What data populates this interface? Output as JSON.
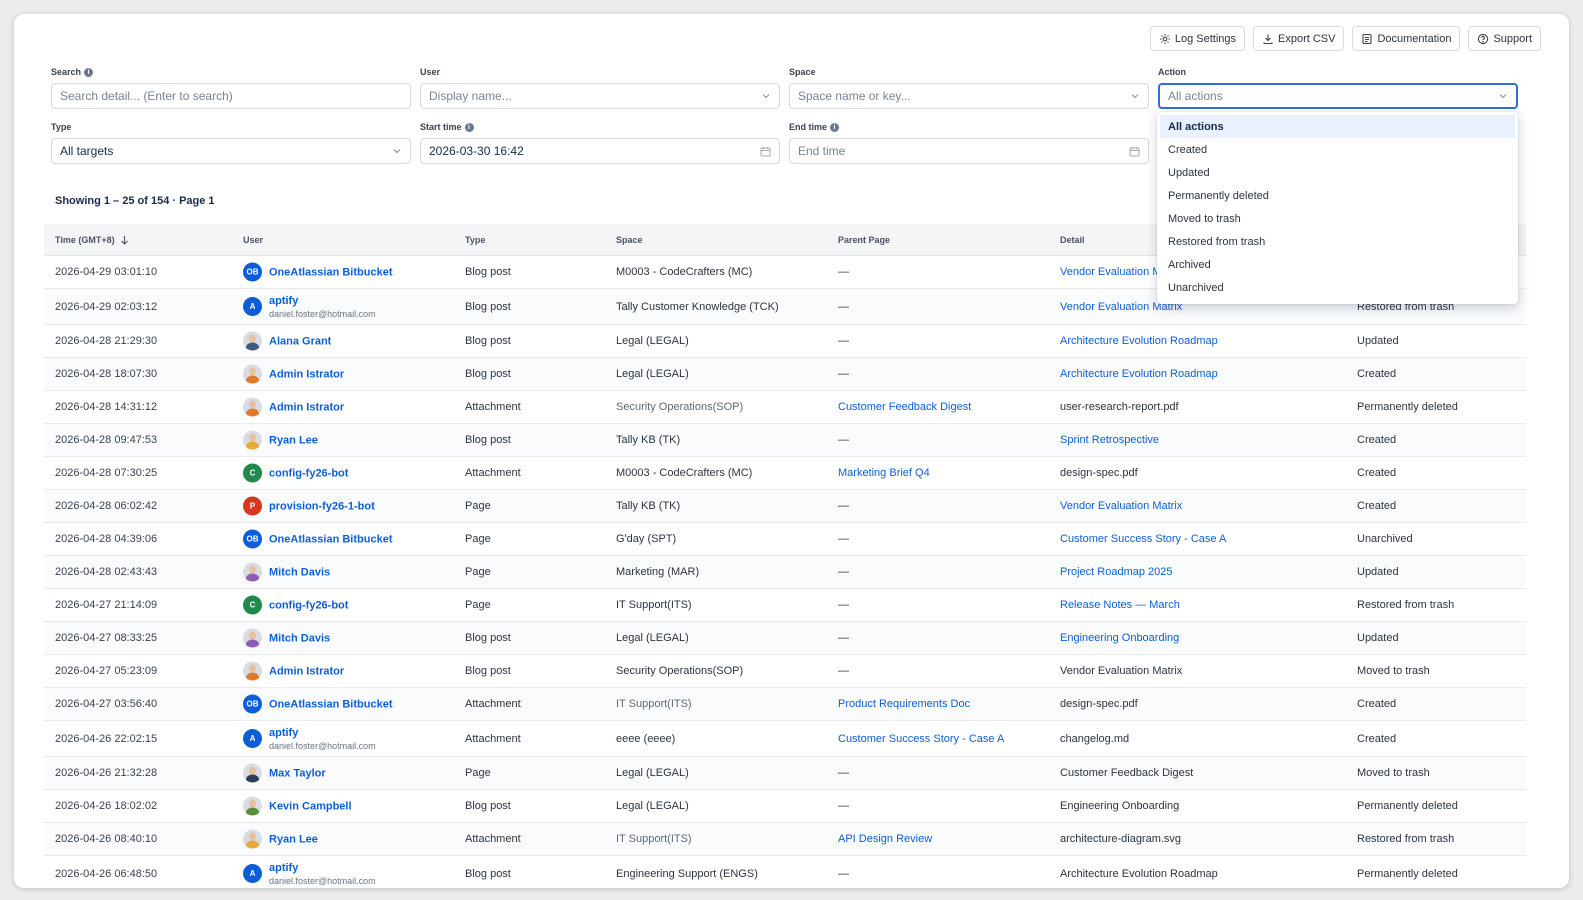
{
  "toolbar": {
    "log_settings": "Log Settings",
    "export_csv": "Export CSV",
    "documentation": "Documentation",
    "support": "Support"
  },
  "filters": {
    "search": {
      "label": "Search",
      "placeholder": "Search detail... (Enter to search)"
    },
    "user": {
      "label": "User",
      "placeholder": "Display name..."
    },
    "space": {
      "label": "Space",
      "placeholder": "Space name or key..."
    },
    "action": {
      "label": "Action",
      "value": "All actions"
    },
    "type": {
      "label": "Type",
      "value": "All targets"
    },
    "start_time": {
      "label": "Start time",
      "value": "2026-03-30 16:42"
    },
    "end_time": {
      "label": "End time",
      "placeholder": "End time"
    }
  },
  "action_menu": {
    "options": [
      "All actions",
      "Created",
      "Updated",
      "Permanently deleted",
      "Moved to trash",
      "Restored from trash",
      "Archived",
      "Unarchived"
    ],
    "selected": "All actions"
  },
  "summary": "Showing 1 – 25 of 154 · Page 1",
  "table": {
    "headers": {
      "time": "Time (GMT+8)",
      "user": "User",
      "type": "Type",
      "space": "Space",
      "parent": "Parent Page",
      "detail": "Detail"
    },
    "rows": [
      {
        "time": "2026-04-29 03:01:10",
        "user": "OneAtlassian Bitbucket",
        "initials": "OB",
        "avatar": "initials",
        "color": "#0b5ed7",
        "type": "Blog post",
        "space": "M0003 - CodeCrafters (MC)",
        "parent": "—",
        "detail": "Vendor Evaluation Matrix",
        "detail_link": true,
        "action": ""
      },
      {
        "time": "2026-04-29 02:03:12",
        "user": "aptify",
        "email": "daniel.foster@hotmail.com",
        "initials": "A",
        "avatar": "initials",
        "color": "#0b5ed7",
        "type": "Blog post",
        "space": "Tally Customer Knowledge (TCK)",
        "parent": "—",
        "detail": "Vendor Evaluation Matrix",
        "detail_link": true,
        "action": "Restored from trash"
      },
      {
        "time": "2026-04-28 21:29:30",
        "user": "Alana Grant",
        "avatar": "photo",
        "color": "#3d5a80",
        "type": "Blog post",
        "space": "Legal (LEGAL)",
        "parent": "—",
        "detail": "Architecture Evolution Roadmap",
        "detail_link": true,
        "action": "Updated"
      },
      {
        "time": "2026-04-28 18:07:30",
        "user": "Admin Istrator",
        "avatar": "photo",
        "color": "#e07a2f",
        "type": "Blog post",
        "space": "Legal (LEGAL)",
        "parent": "—",
        "detail": "Architecture Evolution Roadmap",
        "detail_link": true,
        "action": "Created"
      },
      {
        "time": "2026-04-28 14:31:12",
        "user": "Admin Istrator",
        "avatar": "photo",
        "color": "#e07a2f",
        "type": "Attachment",
        "space": "Security Operations(SOP)",
        "space_muted": true,
        "parent": "Customer Feedback Digest",
        "parent_link": true,
        "detail": "user-research-report.pdf",
        "action": "Permanently deleted"
      },
      {
        "time": "2026-04-28 09:47:53",
        "user": "Ryan Lee",
        "avatar": "photo",
        "color": "#e8a93a",
        "type": "Blog post",
        "space": "Tally KB (TK)",
        "parent": "—",
        "detail": "Sprint Retrospective",
        "detail_link": true,
        "action": "Created"
      },
      {
        "time": "2026-04-28 07:30:25",
        "user": "config-fy26-bot",
        "initials": "C",
        "avatar": "initials",
        "color": "#1f8a4c",
        "type": "Attachment",
        "space": "M0003 - CodeCrafters (MC)",
        "parent": "Marketing Brief Q4",
        "parent_link": true,
        "detail": "design-spec.pdf",
        "action": "Created"
      },
      {
        "time": "2026-04-28 06:02:42",
        "user": "provision-fy26-1-bot",
        "initials": "P",
        "avatar": "initials",
        "color": "#d9361e",
        "type": "Page",
        "space": "Tally KB (TK)",
        "parent": "—",
        "detail": "Vendor Evaluation Matrix",
        "detail_link": true,
        "action": "Created"
      },
      {
        "time": "2026-04-28 04:39:06",
        "user": "OneAtlassian Bitbucket",
        "initials": "OB",
        "avatar": "initials",
        "color": "#0b5ed7",
        "type": "Page",
        "space": "G'day (SPT)",
        "parent": "—",
        "detail": "Customer Success Story - Case A",
        "detail_link": true,
        "action": "Unarchived"
      },
      {
        "time": "2026-04-28 02:43:43",
        "user": "Mitch Davis",
        "avatar": "photo",
        "color": "#8e5bb5",
        "type": "Page",
        "space": "Marketing (MAR)",
        "parent": "—",
        "detail": "Project Roadmap 2025",
        "detail_link": true,
        "action": "Updated"
      },
      {
        "time": "2026-04-27 21:14:09",
        "user": "config-fy26-bot",
        "initials": "C",
        "avatar": "initials",
        "color": "#1f8a4c",
        "type": "Page",
        "space": "IT Support(ITS)",
        "parent": "—",
        "detail": "Release Notes — March",
        "detail_link": true,
        "action": "Restored from trash"
      },
      {
        "time": "2026-04-27 08:33:25",
        "user": "Mitch Davis",
        "avatar": "photo",
        "color": "#8e5bb5",
        "type": "Blog post",
        "space": "Legal (LEGAL)",
        "parent": "—",
        "detail": "Engineering Onboarding",
        "detail_link": true,
        "action": "Updated"
      },
      {
        "time": "2026-04-27 05:23:09",
        "user": "Admin Istrator",
        "avatar": "photo",
        "color": "#e07a2f",
        "type": "Blog post",
        "space": "Security Operations(SOP)",
        "parent": "—",
        "detail": "Vendor Evaluation Matrix",
        "action": "Moved to trash"
      },
      {
        "time": "2026-04-27 03:56:40",
        "user": "OneAtlassian Bitbucket",
        "initials": "OB",
        "avatar": "initials",
        "color": "#0b5ed7",
        "type": "Attachment",
        "space": "IT Support(ITS)",
        "space_muted": true,
        "parent": "Product Requirements Doc",
        "parent_link": true,
        "detail": "design-spec.pdf",
        "action": "Created"
      },
      {
        "time": "2026-04-26 22:02:15",
        "user": "aptify",
        "email": "daniel.foster@hotmail.com",
        "initials": "A",
        "avatar": "initials",
        "color": "#0b5ed7",
        "type": "Attachment",
        "space": "eeee (eeee)",
        "parent": "Customer Success Story - Case A",
        "parent_link": true,
        "detail": "changelog.md",
        "action": "Created"
      },
      {
        "time": "2026-04-26 21:32:28",
        "user": "Max Taylor",
        "avatar": "photo",
        "color": "#2d3e55",
        "type": "Page",
        "space": "Legal (LEGAL)",
        "parent": "—",
        "detail": "Customer Feedback Digest",
        "action": "Moved to trash"
      },
      {
        "time": "2026-04-26 18:02:02",
        "user": "Kevin Campbell",
        "avatar": "photo",
        "color": "#5a8f3c",
        "type": "Blog post",
        "space": "Legal (LEGAL)",
        "parent": "—",
        "detail": "Engineering Onboarding",
        "action": "Permanently deleted"
      },
      {
        "time": "2026-04-26 08:40:10",
        "user": "Ryan Lee",
        "avatar": "photo",
        "color": "#e8a93a",
        "type": "Attachment",
        "space": "IT Support(ITS)",
        "space_muted": true,
        "parent": "API Design Review",
        "parent_link": true,
        "detail": "architecture-diagram.svg",
        "action": "Restored from trash"
      },
      {
        "time": "2026-04-26 06:48:50",
        "user": "aptify",
        "email": "daniel.foster@hotmail.com",
        "initials": "A",
        "avatar": "initials",
        "color": "#0b5ed7",
        "type": "Blog post",
        "space": "Engineering Support (ENGS)",
        "parent": "—",
        "detail": "Architecture Evolution Roadmap",
        "action": "Permanently deleted"
      }
    ]
  }
}
